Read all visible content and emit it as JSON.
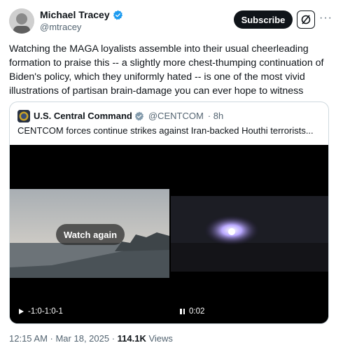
{
  "tweet": {
    "author_name": "Michael Tracey",
    "handle": "@mtracey",
    "subscribe_label": "Subscribe",
    "more_label": "···",
    "text": "Watching the MAGA loyalists assemble into their usual cheerleading formation to praise this -- a slightly more chest-thumping continuation of Biden's policy, which they uniformly hated -- is one of the most vivid illustrations of partisan brain-damage you can ever hope to witness",
    "timestamp": "12:15 AM · Mar 18, 2025 · ",
    "views_count": "114.1K",
    "views_label": "Views"
  },
  "quote": {
    "author_name": "U.S. Central Command",
    "handle": "@CENTCOM",
    "age": "· 8h",
    "text": "CENTCOM forces continue strikes against Iran-backed Houthi terrorists...",
    "video1": {
      "overlay_label": "Watch again",
      "time": "-1:0-1:0-1"
    },
    "video2": {
      "time": "0:02"
    }
  },
  "colors": {
    "verified": "#1d9bf0",
    "gold_badge": "#e2b719",
    "text_muted": "#536471",
    "border": "#cfd9de"
  },
  "icons": [
    "verified-badge-icon",
    "grok-icon",
    "more-icon",
    "play-icon",
    "pause-icon"
  ]
}
